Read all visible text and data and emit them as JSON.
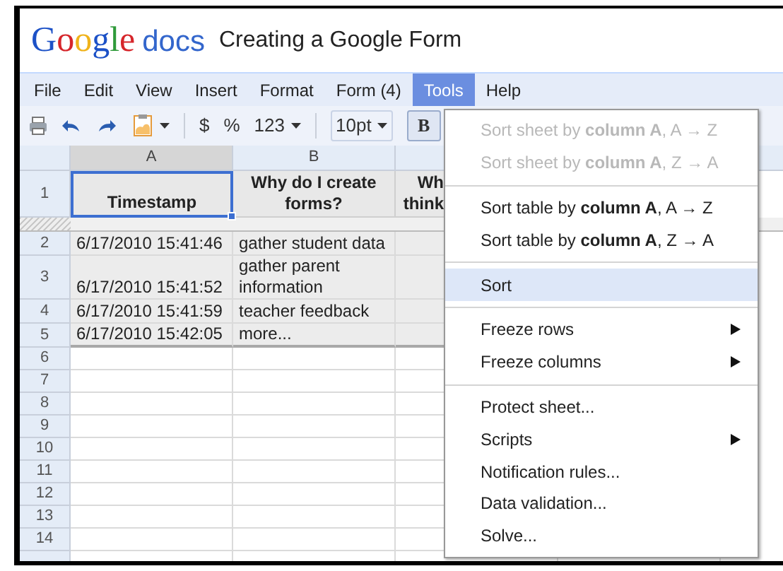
{
  "header": {
    "logo_google": "Google",
    "logo_docs": "docs",
    "title": "Creating a Google Form"
  },
  "menu_bar": [
    {
      "label": "File",
      "selected": false
    },
    {
      "label": "Edit",
      "selected": false
    },
    {
      "label": "View",
      "selected": false
    },
    {
      "label": "Insert",
      "selected": false
    },
    {
      "label": "Format",
      "selected": false
    },
    {
      "label": "Form (4)",
      "selected": false
    },
    {
      "label": "Tools",
      "selected": true
    },
    {
      "label": "Help",
      "selected": false
    }
  ],
  "toolbar": {
    "currency": "$",
    "percent": "%",
    "number_format": "123",
    "font_size": "10pt",
    "bold": "B"
  },
  "sheet": {
    "columns": [
      {
        "label": "A",
        "selected": true
      },
      {
        "label": "B",
        "selected": false
      }
    ],
    "header_row": {
      "number": "1",
      "cells": [
        "Timestamp",
        "Why do I create forms?",
        "Wh think"
      ]
    },
    "rows": [
      {
        "number": "2",
        "tall": false,
        "cells": [
          "6/17/2010 15:41:46",
          "gather student data"
        ]
      },
      {
        "number": "3",
        "tall": true,
        "cells": [
          "6/17/2010 15:41:52",
          "gather parent information"
        ]
      },
      {
        "number": "4",
        "tall": false,
        "cells": [
          "6/17/2010 15:41:59",
          "teacher feedback"
        ]
      },
      {
        "number": "5",
        "tall": false,
        "cells": [
          "6/17/2010 15:42:05",
          "more..."
        ]
      }
    ],
    "empty_rows": [
      "6",
      "7",
      "8",
      "9",
      "10",
      "11",
      "12",
      "13",
      "14"
    ]
  },
  "tools_menu": [
    {
      "kind": "item",
      "label": "Sort sheet by **column A**, A → Z",
      "disabled": true,
      "selected": false,
      "submenu": false
    },
    {
      "kind": "item",
      "label": "Sort sheet by **column A**, Z → A",
      "disabled": true,
      "selected": false,
      "submenu": false
    },
    {
      "kind": "separator"
    },
    {
      "kind": "item",
      "label": "Sort table by **column A**, A → Z",
      "disabled": false,
      "selected": false,
      "submenu": false
    },
    {
      "kind": "item",
      "label": "Sort table by **column A**, Z → A",
      "disabled": false,
      "selected": false,
      "submenu": false
    },
    {
      "kind": "separator"
    },
    {
      "kind": "item",
      "label": "Sort",
      "disabled": false,
      "selected": true,
      "submenu": false
    },
    {
      "kind": "separator"
    },
    {
      "kind": "item",
      "label": "Freeze rows",
      "disabled": false,
      "selected": false,
      "submenu": true
    },
    {
      "kind": "item",
      "label": "Freeze columns",
      "disabled": false,
      "selected": false,
      "submenu": true
    },
    {
      "kind": "separator"
    },
    {
      "kind": "item",
      "label": "Protect sheet...",
      "disabled": false,
      "selected": false,
      "submenu": false
    },
    {
      "kind": "item",
      "label": "Scripts",
      "disabled": false,
      "selected": false,
      "submenu": true
    },
    {
      "kind": "item",
      "label": "Notification rules...",
      "disabled": false,
      "selected": false,
      "submenu": false
    },
    {
      "kind": "item",
      "label": "Data validation...",
      "disabled": false,
      "selected": false,
      "submenu": false
    },
    {
      "kind": "item",
      "label": "Solve...",
      "disabled": false,
      "selected": false,
      "submenu": false
    }
  ]
}
